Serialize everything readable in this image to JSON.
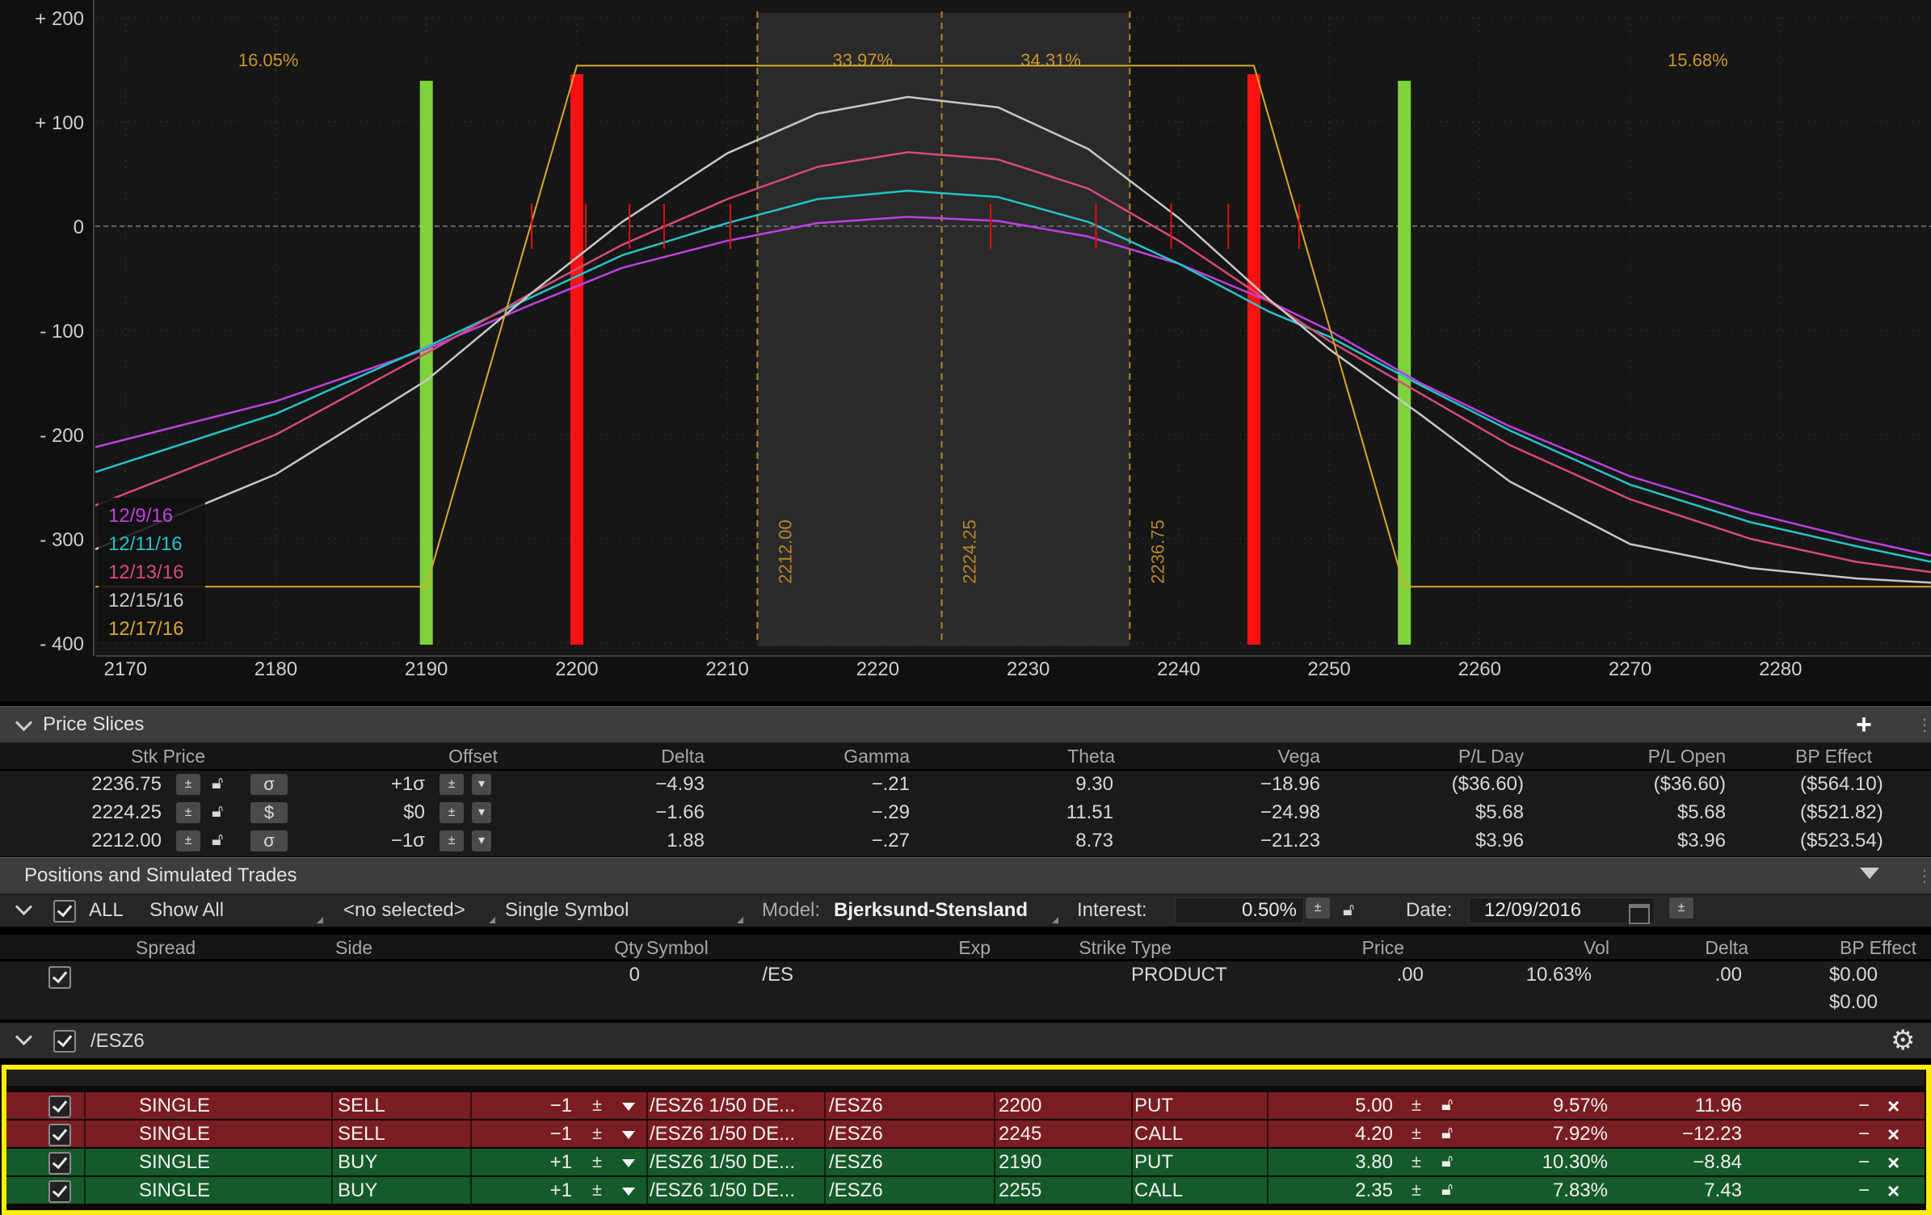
{
  "chart": {
    "y_ticks": [
      "+ 200",
      "+ 100",
      "0",
      "- 100",
      "- 200",
      "- 300",
      "- 400"
    ],
    "x_ticks": [
      "2170",
      "2180",
      "2190",
      "2200",
      "2210",
      "2220",
      "2230",
      "2240",
      "2250",
      "2260",
      "2270",
      "2280"
    ],
    "prob_labels": [
      "16.05%",
      "33.97%",
      "34.31%",
      "15.68%"
    ],
    "slice_labels": [
      "2212.00",
      "2224.25",
      "2236.75"
    ],
    "legend": [
      {
        "label": "12/9/16",
        "color": "#c040e0"
      },
      {
        "label": "12/11/16",
        "color": "#22c4c8"
      },
      {
        "label": "12/13/16",
        "color": "#d84a7a"
      },
      {
        "label": "12/15/16",
        "color": "#c8c8c8"
      },
      {
        "label": "12/17/16",
        "color": "#d8a82a"
      }
    ],
    "colors": {
      "short_strike": "#ff1010",
      "long_strike": "#7fd23c",
      "expiration": "#d8a82a",
      "slice_line": "#b8862a"
    }
  },
  "chart_data": {
    "type": "line",
    "xlim": [
      2168,
      2290
    ],
    "ylim": [
      -400,
      200
    ],
    "strikes": {
      "short": [
        2200,
        2245
      ],
      "long": [
        2190,
        2255
      ]
    },
    "price_slices": [
      2212.0,
      2224.25,
      2236.75
    ],
    "probabilities": [
      "16.05%",
      "33.97%",
      "34.31%",
      "15.68%"
    ],
    "series": [
      {
        "name": "12/9/16",
        "color": "#c040e0",
        "points": [
          [
            2168,
            -212
          ],
          [
            2180,
            -168
          ],
          [
            2190,
            -118
          ],
          [
            2197,
            -75
          ],
          [
            2203,
            -40
          ],
          [
            2210,
            -14
          ],
          [
            2216,
            3
          ],
          [
            2222,
            9
          ],
          [
            2228,
            5
          ],
          [
            2234,
            -10
          ],
          [
            2240,
            -36
          ],
          [
            2246,
            -72
          ],
          [
            2250,
            -100
          ],
          [
            2256,
            -150
          ],
          [
            2262,
            -192
          ],
          [
            2270,
            -240
          ],
          [
            2278,
            -275
          ],
          [
            2285,
            -300
          ],
          [
            2290,
            -316
          ]
        ]
      },
      {
        "name": "12/11/16",
        "color": "#22c4c8",
        "points": [
          [
            2168,
            -236
          ],
          [
            2180,
            -180
          ],
          [
            2190,
            -116
          ],
          [
            2197,
            -68
          ],
          [
            2203,
            -28
          ],
          [
            2210,
            3
          ],
          [
            2216,
            26
          ],
          [
            2222,
            34
          ],
          [
            2228,
            28
          ],
          [
            2234,
            4
          ],
          [
            2240,
            -36
          ],
          [
            2246,
            -82
          ],
          [
            2250,
            -106
          ],
          [
            2256,
            -152
          ],
          [
            2262,
            -196
          ],
          [
            2270,
            -248
          ],
          [
            2278,
            -284
          ],
          [
            2285,
            -307
          ],
          [
            2290,
            -322
          ]
        ]
      },
      {
        "name": "12/13/16",
        "color": "#d84a7a",
        "points": [
          [
            2168,
            -268
          ],
          [
            2180,
            -200
          ],
          [
            2190,
            -122
          ],
          [
            2197,
            -64
          ],
          [
            2203,
            -18
          ],
          [
            2210,
            26
          ],
          [
            2216,
            57
          ],
          [
            2222,
            71
          ],
          [
            2228,
            64
          ],
          [
            2234,
            36
          ],
          [
            2240,
            -14
          ],
          [
            2246,
            -72
          ],
          [
            2250,
            -110
          ],
          [
            2256,
            -160
          ],
          [
            2262,
            -210
          ],
          [
            2270,
            -262
          ],
          [
            2278,
            -300
          ],
          [
            2285,
            -322
          ],
          [
            2290,
            -332
          ]
        ]
      },
      {
        "name": "12/15/16",
        "color": "#c8c8c8",
        "points": [
          [
            2168,
            -310
          ],
          [
            2180,
            -238
          ],
          [
            2190,
            -148
          ],
          [
            2197,
            -64
          ],
          [
            2203,
            4
          ],
          [
            2210,
            70
          ],
          [
            2216,
            108
          ],
          [
            2222,
            124
          ],
          [
            2228,
            114
          ],
          [
            2234,
            74
          ],
          [
            2240,
            8
          ],
          [
            2246,
            -70
          ],
          [
            2250,
            -118
          ],
          [
            2256,
            -180
          ],
          [
            2262,
            -245
          ],
          [
            2270,
            -305
          ],
          [
            2278,
            -328
          ],
          [
            2285,
            -338
          ],
          [
            2290,
            -342
          ]
        ]
      },
      {
        "name": "12/17/16",
        "color": "#d8a82a",
        "points": [
          [
            2168,
            -346
          ],
          [
            2190,
            -346
          ],
          [
            2200,
            154
          ],
          [
            2245,
            154
          ],
          [
            2255,
            -346
          ],
          [
            2290,
            -346
          ]
        ]
      }
    ]
  },
  "price_slices": {
    "title": "Price Slices",
    "add_label": "+",
    "columns": [
      "Stk Price",
      "Offset",
      "Delta",
      "Gamma",
      "Theta",
      "Vega",
      "P/L Day",
      "P/L Open",
      "BP Effect"
    ],
    "rows": [
      {
        "stk": "2236.75",
        "offset_mode": "σ",
        "offset": "+1σ",
        "delta": "−4.93",
        "gamma": "−.21",
        "theta": "9.30",
        "vega": "−18.96",
        "pl_day": "($36.60)",
        "pl_open": "($36.60)",
        "bp": "($564.10)"
      },
      {
        "stk": "2224.25",
        "offset_mode": "$",
        "offset": "$0",
        "delta": "−1.66",
        "gamma": "−.29",
        "theta": "11.51",
        "vega": "−24.98",
        "pl_day": "$5.68",
        "pl_open": "$5.68",
        "bp": "($521.82)"
      },
      {
        "stk": "2212.00",
        "offset_mode": "σ",
        "offset": "−1σ",
        "delta": "1.88",
        "gamma": "−.27",
        "theta": "8.73",
        "vega": "−21.23",
        "pl_day": "$3.96",
        "pl_open": "$3.96",
        "bp": "($523.54)"
      }
    ]
  },
  "positions": {
    "title": "Positions and Simulated Trades",
    "all_label": "ALL",
    "show_all": "Show All",
    "no_selected": "<no selected>",
    "single_symbol": "Single Symbol",
    "model_label": "Model:",
    "model_value": "Bjerksund-Stensland",
    "interest_label": "Interest:",
    "interest_value": "0.50%",
    "date_label": "Date:",
    "date_value": "12/09/2016",
    "columns": [
      "Spread",
      "Side",
      "Qty",
      "Symbol",
      "Exp",
      "Strike",
      "Type",
      "Price",
      "Vol",
      "Delta",
      "BP Effect"
    ],
    "product_row": {
      "qty": "0",
      "symbol": "/ES",
      "type": "PRODUCT",
      "price": ".00",
      "vol": "10.63%",
      "delta": ".00",
      "bp": "$0.00",
      "bp2": "$0.00"
    },
    "group": "/ESZ6",
    "trades": [
      {
        "style": "red",
        "spread": "SINGLE",
        "side": "SELL",
        "qty": "−1",
        "symbol": "/ESZ6 1/50 DE...",
        "exp": "/ESZ6",
        "strike": "2200",
        "type": "PUT",
        "price": "5.00",
        "vol": "9.57%",
        "delta": "11.96",
        "bp": "−"
      },
      {
        "style": "red",
        "spread": "SINGLE",
        "side": "SELL",
        "qty": "−1",
        "symbol": "/ESZ6 1/50 DE...",
        "exp": "/ESZ6",
        "strike": "2245",
        "type": "CALL",
        "price": "4.20",
        "vol": "7.92%",
        "delta": "−12.23",
        "bp": "−"
      },
      {
        "style": "green",
        "spread": "SINGLE",
        "side": "BUY",
        "qty": "+1",
        "symbol": "/ESZ6 1/50 DE...",
        "exp": "/ESZ6",
        "strike": "2190",
        "type": "PUT",
        "price": "3.80",
        "vol": "10.30%",
        "delta": "−8.84",
        "bp": "−"
      },
      {
        "style": "green",
        "spread": "SINGLE",
        "side": "BUY",
        "qty": "+1",
        "symbol": "/ESZ6 1/50 DE...",
        "exp": "/ESZ6",
        "strike": "2255",
        "type": "CALL",
        "price": "2.35",
        "vol": "7.83%",
        "delta": "7.43",
        "bp": "−"
      }
    ],
    "highlight_color": "#ffee00"
  }
}
